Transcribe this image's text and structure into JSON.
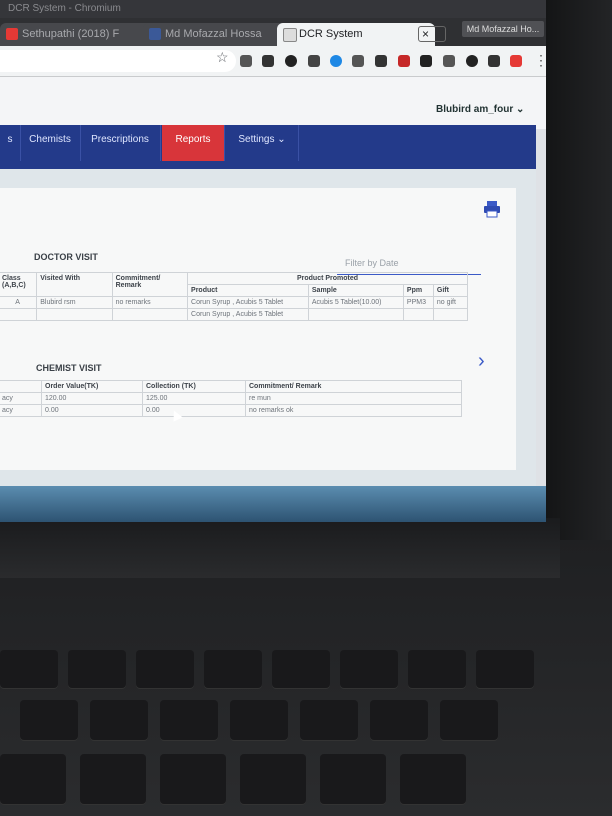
{
  "browser": {
    "window_title": "DCR System - Chromium",
    "tabs": [
      {
        "label": "Sethupathi (2018) F",
        "close": "×",
        "color": "#e53935"
      },
      {
        "label": "Md Mofazzal Hossa",
        "close": "×",
        "color": "#3b5998"
      },
      {
        "label": "DCR System",
        "close": "×",
        "color": "#dddddd"
      }
    ],
    "profile_label": "Md Mofazzal Ho...",
    "star_icon": "☆"
  },
  "site": {
    "user_menu": "Blubird am_four ⌄",
    "nav": [
      {
        "label": "s"
      },
      {
        "label": "Chemists"
      },
      {
        "label": "Prescriptions"
      },
      {
        "label": "Reports"
      },
      {
        "label": "Settings ⌄"
      }
    ],
    "accent_color": "#d8353a",
    "nav_color": "#233a8a"
  },
  "doctor_visit": {
    "title": "DOCTOR VISIT",
    "filter_placeholder": "Filter by Date",
    "headers": {
      "class": "Class (A,B,C)",
      "visited_with": "Visited With",
      "commitment": "Commitment/ Remark",
      "product_promoted": "Product Promoted",
      "product": "Product",
      "sample": "Sample",
      "ppm": "Ppm",
      "gift": "Gift"
    },
    "row": {
      "class": "A",
      "visited_with": "Blubird rsm",
      "commitment": "no remarks",
      "product": "Corun Syrup , Acubis 5 Tablet",
      "sample": "Acubis 5 Tablet(10.00)",
      "ppm": "PPM3",
      "gift": "no gift"
    },
    "row2_product": "Corun Syrup , Acubis 5 Tablet"
  },
  "chemist_visit": {
    "title": "CHEMIST VISIT",
    "headers": {
      "order_value": "Order Value(TK)",
      "collection": "Collection (TK)",
      "commitment": "Commitment/ Remark"
    },
    "rows": [
      {
        "prefix": "acy",
        "order_value": "120.00",
        "collection": "125.00",
        "remark": "re mun"
      },
      {
        "prefix": "acy",
        "order_value": "0.00",
        "collection": "0.00",
        "remark": "no remarks ok"
      }
    ]
  }
}
